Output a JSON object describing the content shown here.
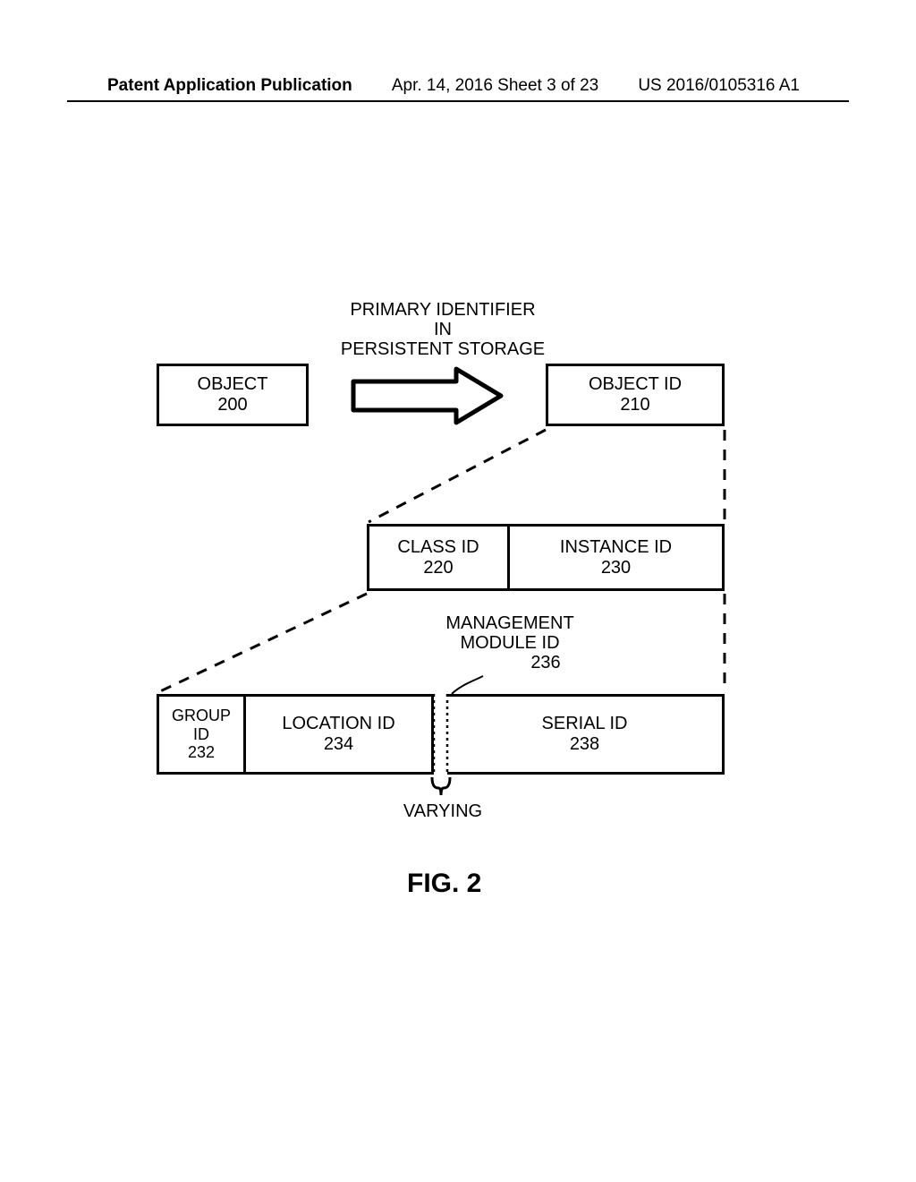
{
  "header": {
    "left": "Patent Application Publication",
    "mid": "Apr. 14, 2016  Sheet 3 of 23",
    "right": "US 2016/0105316 A1"
  },
  "title": {
    "line1": "PRIMARY IDENTIFIER",
    "line2": "IN",
    "line3": "PERSISTENT STORAGE"
  },
  "objectBox": {
    "name": "OBJECT",
    "num": "200"
  },
  "objectIdBox": {
    "name": "OBJECT ID",
    "num": "210"
  },
  "classIdBox": {
    "name": "CLASS ID",
    "num": "220"
  },
  "instanceIdBox": {
    "name": "INSTANCE ID",
    "num": "230"
  },
  "mmLabel": {
    "line1": "MANAGEMENT",
    "line2": "MODULE ID",
    "num": "236"
  },
  "groupIdBox": {
    "name1": "GROUP",
    "name2": "ID",
    "num": "232"
  },
  "locationIdBox": {
    "name": "LOCATION ID",
    "num": "234"
  },
  "serialIdBox": {
    "name": "SERIAL ID",
    "num": "238"
  },
  "varying": "VARYING",
  "figure": "FIG. 2"
}
